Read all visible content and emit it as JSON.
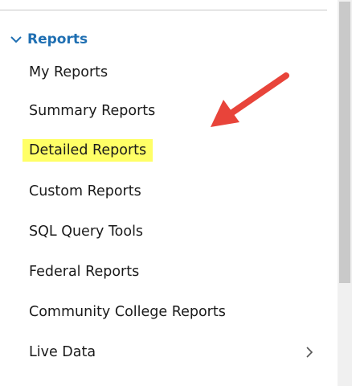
{
  "nav": {
    "section_title": "Reports",
    "items": [
      {
        "label": "My Reports"
      },
      {
        "label": "Summary Reports"
      },
      {
        "label": "Detailed Reports"
      },
      {
        "label": "Custom Reports"
      },
      {
        "label": "SQL Query Tools"
      },
      {
        "label": "Federal Reports"
      },
      {
        "label": "Community College Reports"
      },
      {
        "label": "Live Data"
      }
    ],
    "highlighted_item": "Detailed Reports"
  },
  "colors": {
    "section_header": "#1f6fb2",
    "highlight": "#ffff66",
    "arrow": "#e8443a"
  }
}
